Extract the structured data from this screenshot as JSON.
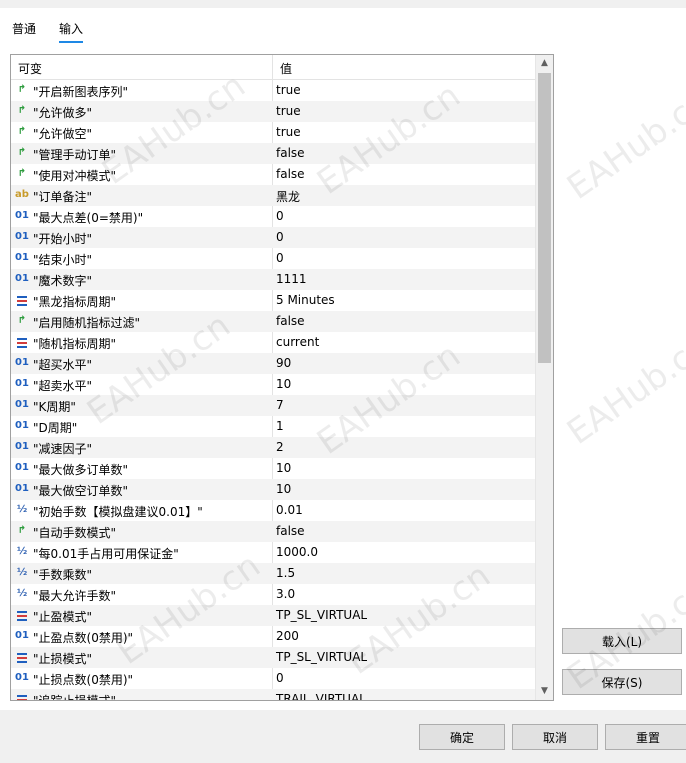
{
  "tabs": [
    {
      "label": "普通",
      "active": false
    },
    {
      "label": "输入",
      "active": true
    }
  ],
  "grid": {
    "col_variable": "可变",
    "col_value": "值",
    "rows": [
      {
        "type": "bool",
        "icon_label": "",
        "name": "\"开启新图表序列\"",
        "value": "true"
      },
      {
        "type": "bool",
        "icon_label": "",
        "name": "\"允许做多\"",
        "value": "true"
      },
      {
        "type": "bool",
        "icon_label": "",
        "name": "\"允许做空\"",
        "value": "true"
      },
      {
        "type": "bool",
        "icon_label": "",
        "name": "\"管理手动订单\"",
        "value": "false"
      },
      {
        "type": "bool",
        "icon_label": "",
        "name": "\"使用对冲模式\"",
        "value": "false"
      },
      {
        "type": "string",
        "icon_label": "ab",
        "name": "\"订单备注\"",
        "value": "黑龙"
      },
      {
        "type": "int",
        "icon_label": "01",
        "name": "\"最大点差(0=禁用)\"",
        "value": "0"
      },
      {
        "type": "int",
        "icon_label": "01",
        "name": "\"开始小时\"",
        "value": "0"
      },
      {
        "type": "int",
        "icon_label": "01",
        "name": "\"结束小时\"",
        "value": "0"
      },
      {
        "type": "int",
        "icon_label": "01",
        "name": "\"魔术数字\"",
        "value": "1111"
      },
      {
        "type": "enum",
        "icon_label": "",
        "name": "\"黑龙指标周期\"",
        "value": "5 Minutes"
      },
      {
        "type": "bool",
        "icon_label": "",
        "name": "\"启用随机指标过滤\"",
        "value": "false"
      },
      {
        "type": "enum",
        "icon_label": "",
        "name": "\"随机指标周期\"",
        "value": "current"
      },
      {
        "type": "int",
        "icon_label": "01",
        "name": "\"超买水平\"",
        "value": "90"
      },
      {
        "type": "int",
        "icon_label": "01",
        "name": "\"超卖水平\"",
        "value": "10"
      },
      {
        "type": "int",
        "icon_label": "01",
        "name": "\"K周期\"",
        "value": "7"
      },
      {
        "type": "int",
        "icon_label": "01",
        "name": "\"D周期\"",
        "value": "1"
      },
      {
        "type": "int",
        "icon_label": "01",
        "name": "\"减速因子\"",
        "value": "2"
      },
      {
        "type": "int",
        "icon_label": "01",
        "name": "\"最大做多订单数\"",
        "value": "10"
      },
      {
        "type": "int",
        "icon_label": "01",
        "name": "\"最大做空订单数\"",
        "value": "10"
      },
      {
        "type": "double",
        "icon_label": "½",
        "name": "\"初始手数【模拟盘建议0.01】\"",
        "value": "0.01"
      },
      {
        "type": "bool",
        "icon_label": "",
        "name": "\"自动手数模式\"",
        "value": "false"
      },
      {
        "type": "double",
        "icon_label": "½",
        "name": "\"每0.01手占用可用保证金\"",
        "value": "1000.0"
      },
      {
        "type": "double",
        "icon_label": "½",
        "name": "\"手数乘数\"",
        "value": "1.5"
      },
      {
        "type": "double",
        "icon_label": "½",
        "name": "\"最大允许手数\"",
        "value": "3.0"
      },
      {
        "type": "enum",
        "icon_label": "",
        "name": "\"止盈模式\"",
        "value": "TP_SL_VIRTUAL"
      },
      {
        "type": "int",
        "icon_label": "01",
        "name": "\"止盈点数(0禁用)\"",
        "value": "200"
      },
      {
        "type": "enum",
        "icon_label": "",
        "name": "\"止损模式\"",
        "value": "TP_SL_VIRTUAL"
      },
      {
        "type": "int",
        "icon_label": "01",
        "name": "\"止损点数(0禁用)\"",
        "value": "0"
      },
      {
        "type": "enum",
        "icon_label": "",
        "name": "\"追踪止损模式\"",
        "value": "TRAIL_VIRTUAL"
      }
    ]
  },
  "side_buttons": {
    "load": "载入(L)",
    "save": "保存(S)"
  },
  "bottom_buttons": {
    "ok": "确定",
    "cancel": "取消",
    "reset": "重置"
  },
  "watermark": "EAHub.cn",
  "colors": {
    "bool_icon": "#2e9c3e",
    "int_icon": "#1f5fbf",
    "string_icon": "#c89b2a",
    "enum_bar_top": "#1f5fbf",
    "enum_bar_mid": "#d23c3c",
    "tab_underline": "#1e88e5"
  }
}
